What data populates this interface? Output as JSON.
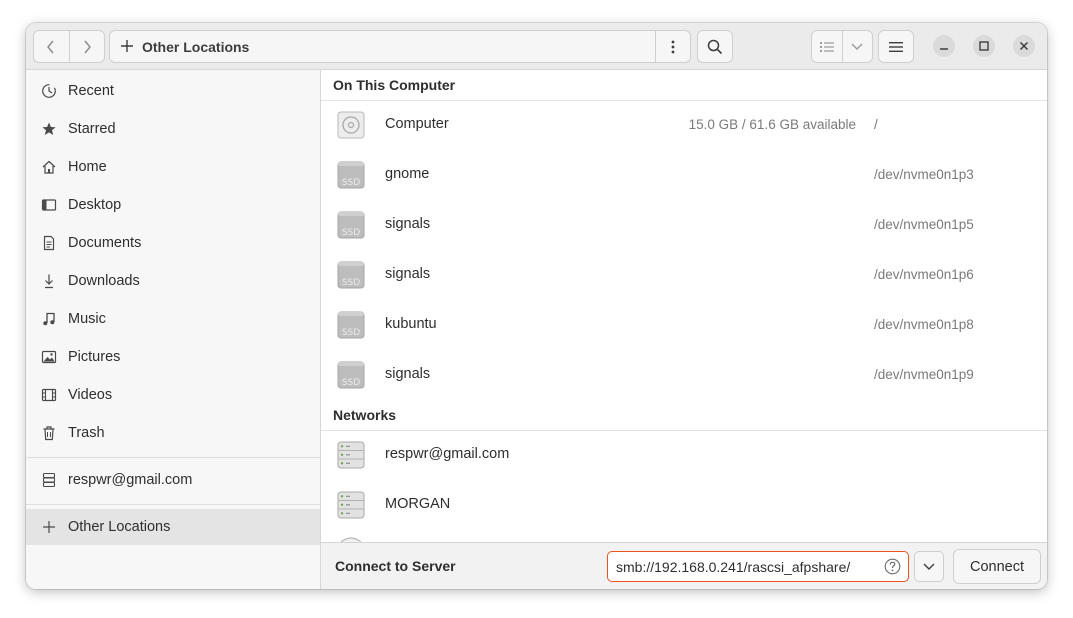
{
  "header": {
    "back_icon": "chevron-left-icon",
    "forward_icon": "chevron-right-icon",
    "path_label": "Other Locations",
    "search_icon": "search-icon"
  },
  "sidebar": {
    "items": [
      {
        "label": "Recent",
        "icon": "clock-icon"
      },
      {
        "label": "Starred",
        "icon": "star-icon"
      },
      {
        "label": "Home",
        "icon": "home-icon"
      },
      {
        "label": "Desktop",
        "icon": "desktop-icon"
      },
      {
        "label": "Documents",
        "icon": "document-icon"
      },
      {
        "label": "Downloads",
        "icon": "download-icon"
      },
      {
        "label": "Music",
        "icon": "music-icon"
      },
      {
        "label": "Pictures",
        "icon": "pictures-icon"
      },
      {
        "label": "Videos",
        "icon": "film-icon"
      },
      {
        "label": "Trash",
        "icon": "trash-icon"
      }
    ],
    "account": {
      "label": "respwr@gmail.com",
      "icon": "server-icon"
    },
    "other_locations": {
      "label": "Other Locations",
      "icon": "plus-icon"
    }
  },
  "main": {
    "on_this_computer": {
      "title": "On This Computer",
      "rows": [
        {
          "name": "Computer",
          "available": "15.0 GB / 61.6 GB available",
          "path": "/",
          "icon": "disk-icon"
        },
        {
          "name": "gnome",
          "available": "",
          "path": "/dev/nvme0n1p3",
          "icon": "ssd-icon"
        },
        {
          "name": "signals",
          "available": "",
          "path": "/dev/nvme0n1p5",
          "icon": "ssd-icon"
        },
        {
          "name": "signals",
          "available": "",
          "path": "/dev/nvme0n1p6",
          "icon": "ssd-icon"
        },
        {
          "name": "kubuntu",
          "available": "",
          "path": "/dev/nvme0n1p8",
          "icon": "ssd-icon"
        },
        {
          "name": "signals",
          "available": "",
          "path": "/dev/nvme0n1p9",
          "icon": "ssd-icon"
        }
      ]
    },
    "networks": {
      "title": "Networks",
      "rows": [
        {
          "name": "respwr@gmail.com",
          "icon": "network-server-icon"
        },
        {
          "name": "MORGAN",
          "icon": "network-server-icon"
        }
      ]
    },
    "ssd_label": "SSD"
  },
  "bottom": {
    "label": "Connect to Server",
    "server_value": "smb://192.168.0.241/rascsi_afpshare/",
    "connect_label": "Connect"
  },
  "colors": {
    "accent": "#e95420"
  }
}
